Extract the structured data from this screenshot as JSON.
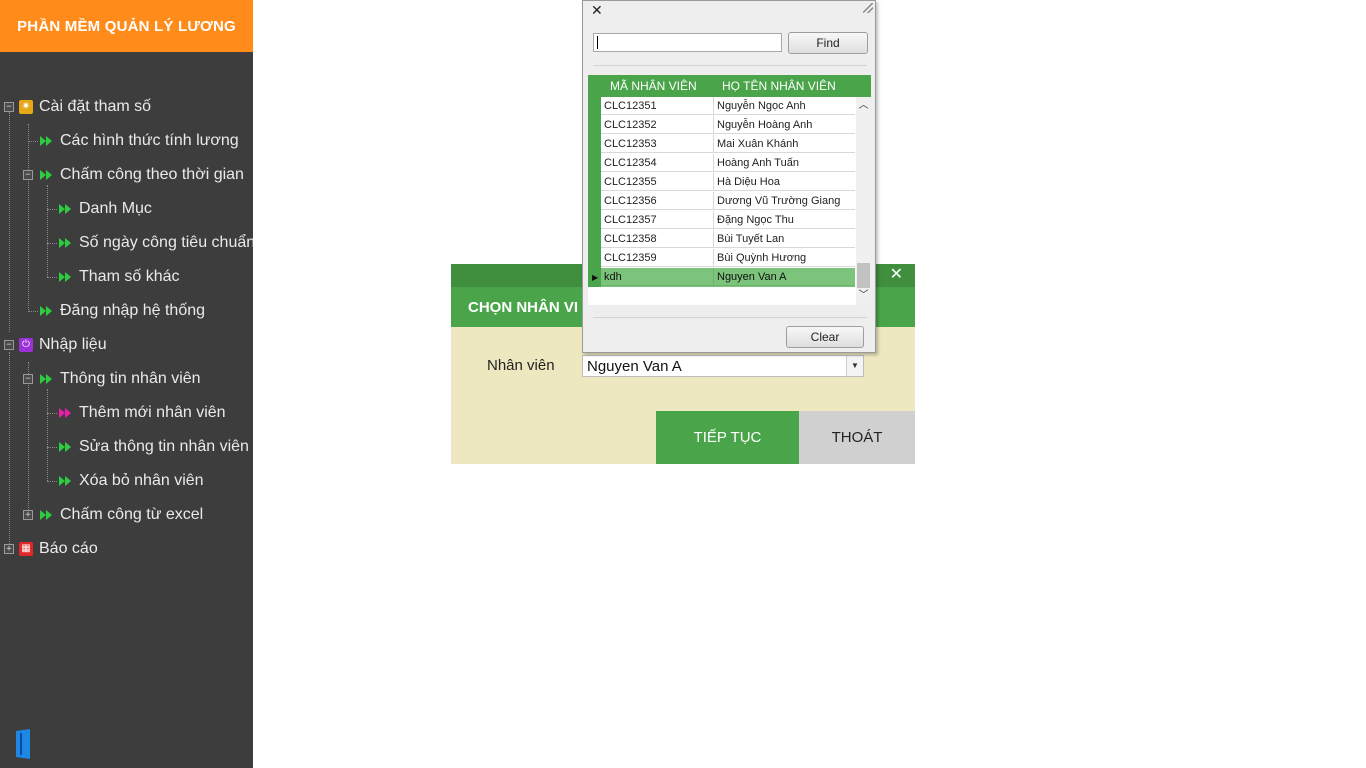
{
  "app": {
    "title": "PHẦN MỀM QUẢN LÝ LƯƠNG"
  },
  "colors": {
    "accent_orange": "#ff8c1a",
    "sidebar_bg": "#3d3d3d",
    "green": "#4aa54a",
    "dark_green": "#3f8f3f",
    "dialog_bg": "#ede8c0",
    "selected_row": "#7cc47c"
  },
  "sidebar": {
    "items": [
      {
        "label": "Cài đặt tham số",
        "icon": "gear-icon"
      },
      {
        "label": "Các hình thức tính lương",
        "icon": "green-arrow-icon"
      },
      {
        "label": "Chấm công theo thời gian",
        "icon": "green-arrow-icon"
      },
      {
        "label": "Danh Mục",
        "icon": "green-arrow-icon"
      },
      {
        "label": "Số ngày công tiêu chuẩn",
        "icon": "green-arrow-icon"
      },
      {
        "label": "Tham số khác",
        "icon": "green-arrow-icon"
      },
      {
        "label": "Đăng nhập hệ thống",
        "icon": "green-arrow-icon"
      },
      {
        "label": "Nhập liệu",
        "icon": "import-icon"
      },
      {
        "label": "Thông tin nhân viên",
        "icon": "green-arrow-icon"
      },
      {
        "label": "Thêm mới nhân viên",
        "icon": "magenta-arrow-icon"
      },
      {
        "label": "Sửa thông tin nhân viên",
        "icon": "green-arrow-icon"
      },
      {
        "label": "Xóa bỏ nhân viên",
        "icon": "green-arrow-icon"
      },
      {
        "label": "Chấm công từ excel",
        "icon": "green-arrow-icon"
      },
      {
        "label": "Báo cáo",
        "icon": "report-icon"
      }
    ]
  },
  "dialog": {
    "header": "CHỌN NHÂN VI",
    "close": "✕",
    "employee_label": "Nhân  viên",
    "employee_value": "Nguyen Van A",
    "next_button": "TIẾP TỤC",
    "exit_button": "THOÁT"
  },
  "popup": {
    "close": "✕",
    "find_button": "Find",
    "clear_button": "Clear",
    "search_value": "",
    "columns": [
      "MÃ NHÂN VIÊN",
      "HỌ TÊN NHÂN VIÊN"
    ],
    "rows": [
      {
        "code": "CLC12351",
        "name": "Nguyễn Ngọc Anh"
      },
      {
        "code": "CLC12352",
        "name": "Nguyễn Hoàng Anh"
      },
      {
        "code": "CLC12353",
        "name": "Mai Xuân Khánh"
      },
      {
        "code": "CLC12354",
        "name": "Hoàng Anh Tuấn"
      },
      {
        "code": "CLC12355",
        "name": "Hà Diệu Hoa"
      },
      {
        "code": "CLC12356",
        "name": "Dương Vũ Trường Giang"
      },
      {
        "code": "CLC12357",
        "name": "Đặng Ngọc Thu"
      },
      {
        "code": "CLC12358",
        "name": "Bùi Tuyết Lan"
      },
      {
        "code": "CLC12359",
        "name": "Bùi Quỳnh Hương"
      },
      {
        "code": "kdh",
        "name": "Nguyen Van A"
      }
    ],
    "selected_index": 9
  }
}
